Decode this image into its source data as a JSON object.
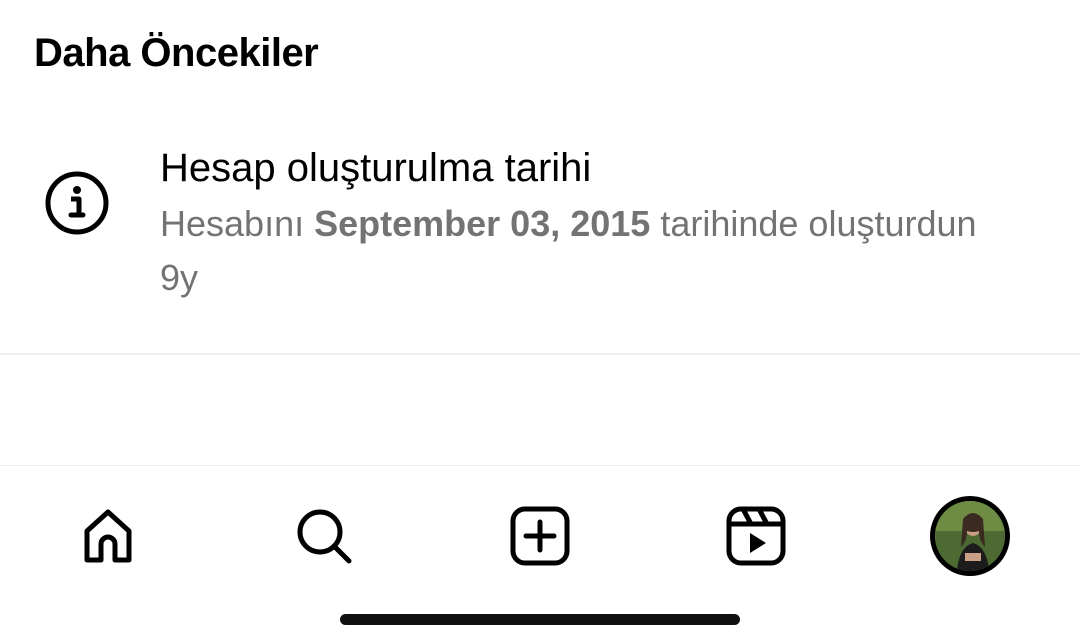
{
  "section": {
    "title": "Daha Öncekiler"
  },
  "activity": {
    "icon": "info-icon",
    "title": "Hesap oluşturulma tarihi",
    "desc_prefix": "Hesabını",
    "desc_date": "September 03, 2015",
    "desc_suffix": "tarihinde oluşturdun",
    "time": "9y"
  },
  "nav": {
    "items": [
      {
        "name": "home",
        "icon": "home-icon"
      },
      {
        "name": "search",
        "icon": "search-icon"
      },
      {
        "name": "create",
        "icon": "plus-square-icon"
      },
      {
        "name": "reels",
        "icon": "reels-icon"
      },
      {
        "name": "profile",
        "icon": "avatar"
      }
    ]
  },
  "colors": {
    "text": "#000000",
    "secondary": "#737373",
    "divider": "#efefef"
  }
}
